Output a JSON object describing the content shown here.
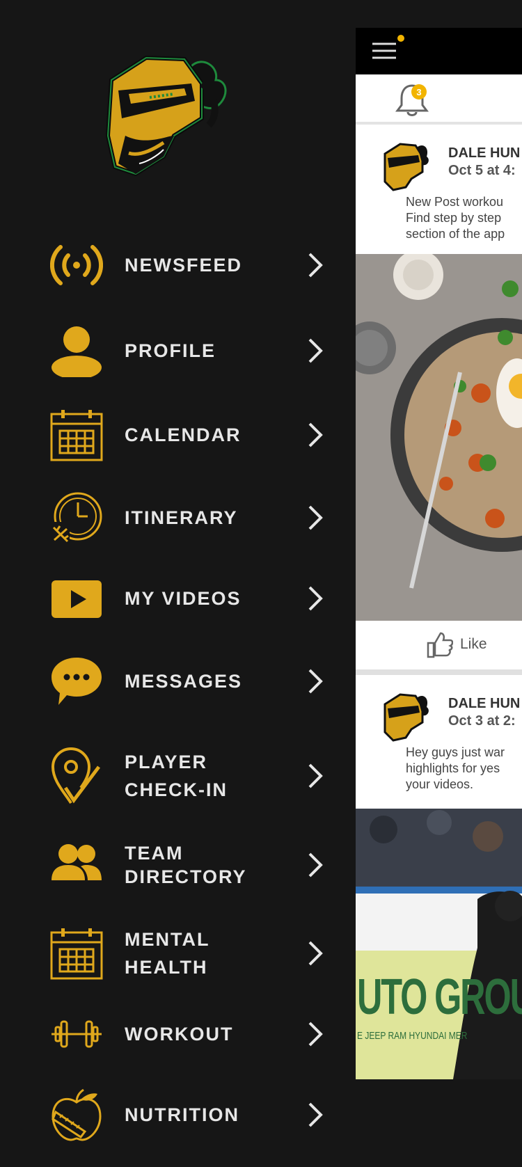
{
  "colors": {
    "accent": "#e0a81c",
    "background": "#161616",
    "label": "#e7e7e7"
  },
  "logo": {
    "name": "knight-helmet-logo"
  },
  "menu": [
    {
      "label": "NEWSFEED",
      "icon": "broadcast-icon"
    },
    {
      "label": "PROFILE",
      "icon": "person-icon"
    },
    {
      "label": "CALENDAR",
      "icon": "calendar-icon"
    },
    {
      "label": "ITINERARY",
      "icon": "clock-plane-icon"
    },
    {
      "label": "MY VIDEOS",
      "icon": "play-icon"
    },
    {
      "label": "MESSAGES",
      "icon": "chat-icon"
    },
    {
      "label": "PLAYER\nCHECK-IN",
      "icon": "location-check-icon"
    },
    {
      "label": "TEAM\nDIRECTORY",
      "icon": "group-icon"
    },
    {
      "label": "MENTAL\nHEALTH",
      "icon": "calendar-icon"
    },
    {
      "label": "WORKOUT",
      "icon": "dumbbell-icon"
    },
    {
      "label": "NUTRITION",
      "icon": "apple-tape-icon"
    }
  ],
  "feed": {
    "notification_count": "3",
    "posts": [
      {
        "author": "DALE HUN",
        "date": "Oct 5 at 4:",
        "text": "New Post workou\nFind step by step\nsection of the app"
      },
      {
        "author": "DALE HUN",
        "date": "Oct 3 at 2:",
        "text": "Hey guys just war\nhighlights for yes\nyour videos."
      }
    ],
    "like_label": "Like",
    "banner": {
      "main": "UTO GROU",
      "sub": "E JEEP RAM HYUNDAI MER"
    }
  }
}
